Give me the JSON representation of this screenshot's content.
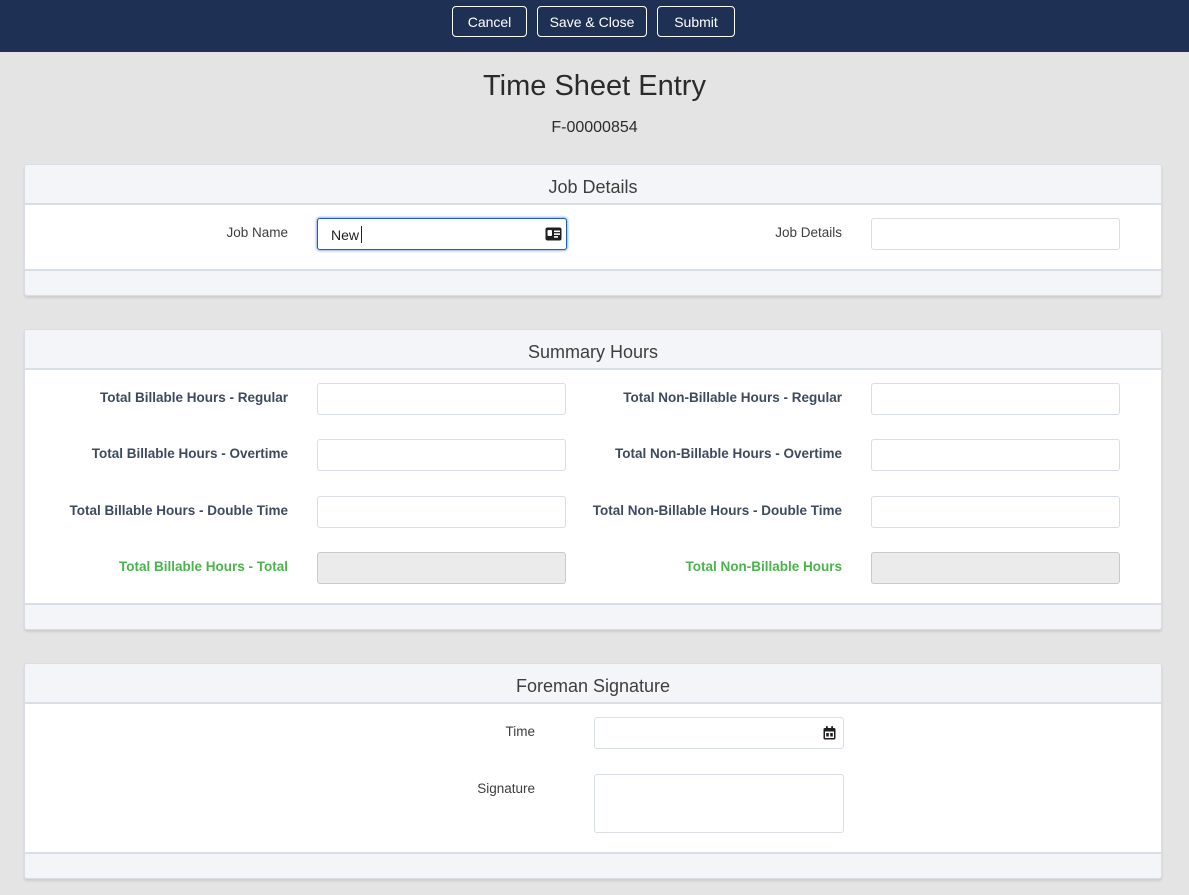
{
  "toolbar": {
    "cancel_label": "Cancel",
    "save_close_label": "Save & Close",
    "submit_label": "Submit"
  },
  "header": {
    "title": "Time Sheet Entry",
    "record_id": "F-00000854"
  },
  "job_details": {
    "title": "Job Details",
    "job_name_label": "Job Name",
    "job_name_value": "New",
    "job_details_label": "Job Details",
    "job_details_value": ""
  },
  "summary_hours": {
    "title": "Summary Hours",
    "billable_regular_label": "Total Billable Hours - Regular",
    "billable_overtime_label": "Total Billable Hours - Overtime",
    "billable_double_label": "Total Billable Hours - Double Time",
    "billable_total_label": "Total Billable Hours - Total",
    "nonbillable_regular_label": "Total Non-Billable Hours - Regular",
    "nonbillable_overtime_label": "Total Non-Billable Hours - Overtime",
    "nonbillable_double_label": "Total Non-Billable Hours - Double Time",
    "nonbillable_total_label": "Total Non-Billable Hours"
  },
  "foreman_signature": {
    "title": "Foreman Signature",
    "time_label": "Time",
    "time_value": "",
    "signature_label": "Signature"
  },
  "icons": {
    "lookup": "contact-card-icon",
    "date": "calendar-icon"
  },
  "colors": {
    "topbar": "#1e3155",
    "calculated_label": "#4bb34d",
    "focus_border": "#1b5fb8"
  }
}
